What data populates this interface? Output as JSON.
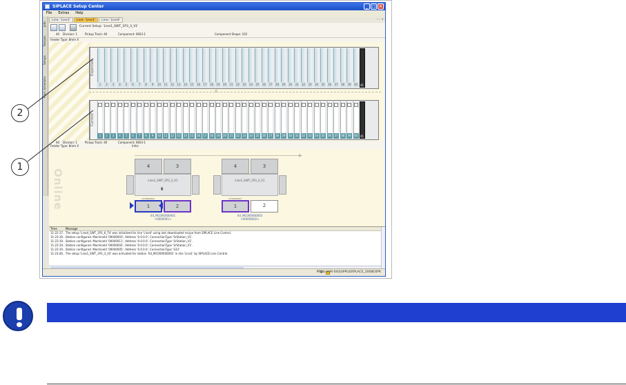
{
  "window": {
    "title": "SIPLACE Setup Center",
    "menu": [
      "File",
      "Extras",
      "Help"
    ]
  },
  "left_tabs": [
    "Jobs",
    "Recipes",
    "Setups",
    "Prod. Scheduler"
  ],
  "tabs": [
    {
      "label": "Line: 'Line1'",
      "active": false
    },
    {
      "label": "Line: 'Line1'",
      "active": true
    },
    {
      "label": "Line: 'Line4'",
      "active": false
    }
  ],
  "tab_controls": "‹ › ×",
  "toolbar": {
    "current_setup": "Current Setup: 'Line1_SWT_1P3_3_V1'",
    "info": {
      "tracks": "40",
      "division": "Division: 1",
      "pickup_track": "Pickup Track: 40",
      "component": "Component: 0603-1",
      "component_shape": "Component Shape: 102"
    }
  },
  "feeder_type": "Feeder Type: 8mm X",
  "expected_label": "Expected",
  "current_label": "Current",
  "track_numbers": [
    "1",
    "2",
    "3",
    "4",
    "5",
    "6",
    "7",
    "8",
    "9",
    "10",
    "11",
    "12",
    "13",
    "14",
    "15",
    "16",
    "17",
    "18",
    "19",
    "20",
    "21",
    "22",
    "23",
    "24",
    "25",
    "26",
    "27",
    "28",
    "29",
    "30",
    "31",
    "32",
    "33",
    "34",
    "35",
    "36",
    "37",
    "38",
    "39",
    "40",
    "41"
  ],
  "info2": {
    "tracks": "40",
    "division": "Division: 1",
    "pickup_track": "Pickup Track: 40",
    "component": "Component: 0603-1",
    "infos": "Infos",
    "feeder_type": "Feeder Type: 8mm X"
  },
  "online": {
    "label": "Online",
    "stations": [
      {
        "name": "Line1_SWT_1P3_3_V1",
        "heads": [
          "4",
          "3"
        ],
        "lanes": [
          "1",
          "2"
        ],
        "tag": "1234000002",
        "caption1": "X4_MC000000001",
        "caption2": "<0000001>"
      },
      {
        "name": "Line1_SWT_1P3_3_V1",
        "heads": [
          "4",
          "3"
        ],
        "lanes": [
          "1",
          "2"
        ],
        "tag": "1234000003",
        "caption1": "X4_MC000000003",
        "caption2": "<00000002>"
      }
    ]
  },
  "log": {
    "columns": [
      "Time",
      "Message"
    ],
    "rows": [
      {
        "time": "11:22:17...",
        "message": "The setup 'Line4_SWT_1P3_6_T4' was initialized for line 'Line4' using last downloaded recipe from SIPLACE Line Control."
      },
      {
        "time": "11:23:19...",
        "message": "Station configured. MachineId '00000003', Address '0.0.0.0', ConnectionType 'SrStation_V1'."
      },
      {
        "time": "11:23:19...",
        "message": "Station configured. MachineId '00000011', Address '0.0.0.0', ConnectionType 'SrStation_V1'."
      },
      {
        "time": "11:23:19...",
        "message": "Station configured. MachineId '00000002', Address '0.0.0.0', ConnectionType 'SrStation_V1'."
      },
      {
        "time": "11:23:19...",
        "message": "Station configured. MachineId '00000005', Address '0.0.0.0', ConnectionType 'S33'."
      },
      {
        "time": "11:23:46...",
        "message": "The setup 'Line1_SWT_1P3_3_V2' was activated for station 'X4_MC000000002' in line 'Line1' by SIPLACE Line Control."
      }
    ]
  },
  "status": {
    "host": "PROG-SVR-04\\SUPPLIERPLACE_2008EXPR"
  },
  "callouts": [
    "2",
    "1"
  ],
  "colors": {
    "notice_header": "#1f3fd1",
    "notice_icon": "#1c3fae",
    "lane_purple": "#6b33c8",
    "lane_blue": "#2638c2",
    "track_current": "#5f9aa6"
  }
}
